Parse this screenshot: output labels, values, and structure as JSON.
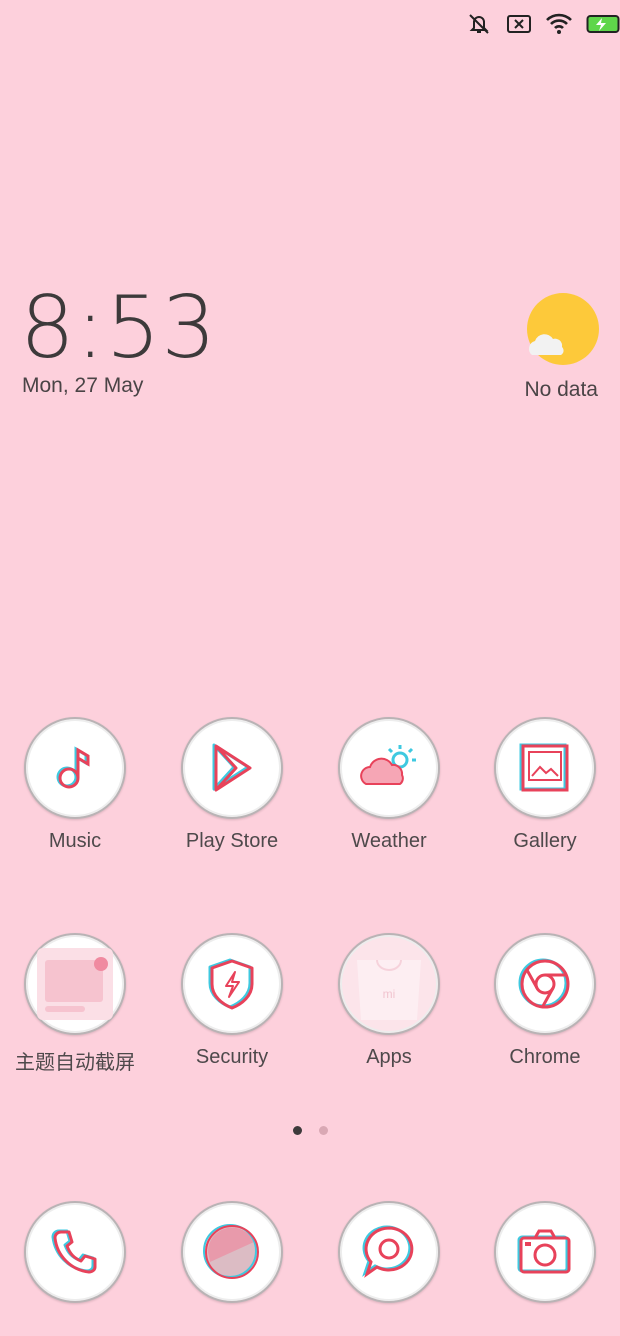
{
  "status_bar": {
    "icons": [
      "mute-icon",
      "no-sim-icon",
      "wifi-icon",
      "battery-charging-icon"
    ]
  },
  "clock": {
    "time": "8:53",
    "date": "Mon, 27 May"
  },
  "weather": {
    "icon": "sun-cloud-icon",
    "label": "No data"
  },
  "apps_row1": [
    {
      "label": "Music",
      "icon": "music-note-icon"
    },
    {
      "label": "Play Store",
      "icon": "play-store-icon"
    },
    {
      "label": "Weather",
      "icon": "weather-icon"
    },
    {
      "label": "Gallery",
      "icon": "gallery-icon"
    }
  ],
  "apps_row2": [
    {
      "label": "主题自动截屏",
      "icon": "screenshot-icon"
    },
    {
      "label": "Security",
      "icon": "shield-icon"
    },
    {
      "label": "Apps",
      "icon": "mi-apps-icon"
    },
    {
      "label": "Chrome",
      "icon": "chrome-icon"
    }
  ],
  "page_indicator": {
    "pages": 2,
    "current": 1
  },
  "dock": [
    {
      "icon": "phone-icon"
    },
    {
      "icon": "browser-icon"
    },
    {
      "icon": "messaging-icon"
    },
    {
      "icon": "camera-icon"
    }
  ],
  "colors": {
    "background": "#fdd0dc",
    "accent_red": "#e8425a",
    "accent_cyan": "#3ec9e0"
  }
}
